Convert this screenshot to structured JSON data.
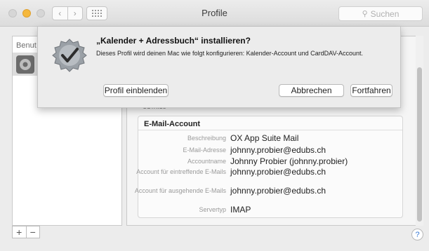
{
  "window": {
    "title": "Profile",
    "search_placeholder": "Suchen"
  },
  "sidebar": {
    "header": "Benut"
  },
  "bottom_controls": {
    "add_label": "+",
    "remove_label": "−",
    "help_label": "?"
  },
  "details": {
    "section_label": "DETAILS",
    "card_title": "E-Mail-Account",
    "rows": [
      {
        "label": "Beschreibung",
        "value": "OX App Suite Mail"
      },
      {
        "label": "E-Mail-Adresse",
        "value": "johnny.probier@edubs.ch"
      },
      {
        "label": "Accountname",
        "value": "Johnny Probier (johnny.probier)"
      },
      {
        "label": "Account für eintreffende E-Mails",
        "value": "johnny.probier@edubs.ch"
      },
      {
        "label": "Account für ausgehende E-Mails",
        "value": "johnny.probier@edubs.ch"
      },
      {
        "label": "Servertyp",
        "value": "IMAP"
      }
    ]
  },
  "dialog": {
    "title": "„Kalender + Adressbuch“ installieren?",
    "message": "Dieses Profil wird deinen Mac wie folgt konfigurieren: Kalender-Account und CardDAV-Account.",
    "show_profile_label": "Profil einblenden",
    "cancel_label": "Abbrechen",
    "continue_label": "Fortfahren"
  },
  "colors": {
    "minimize_yellow": "#f5b83d",
    "help_blue": "#3a7bd5"
  }
}
